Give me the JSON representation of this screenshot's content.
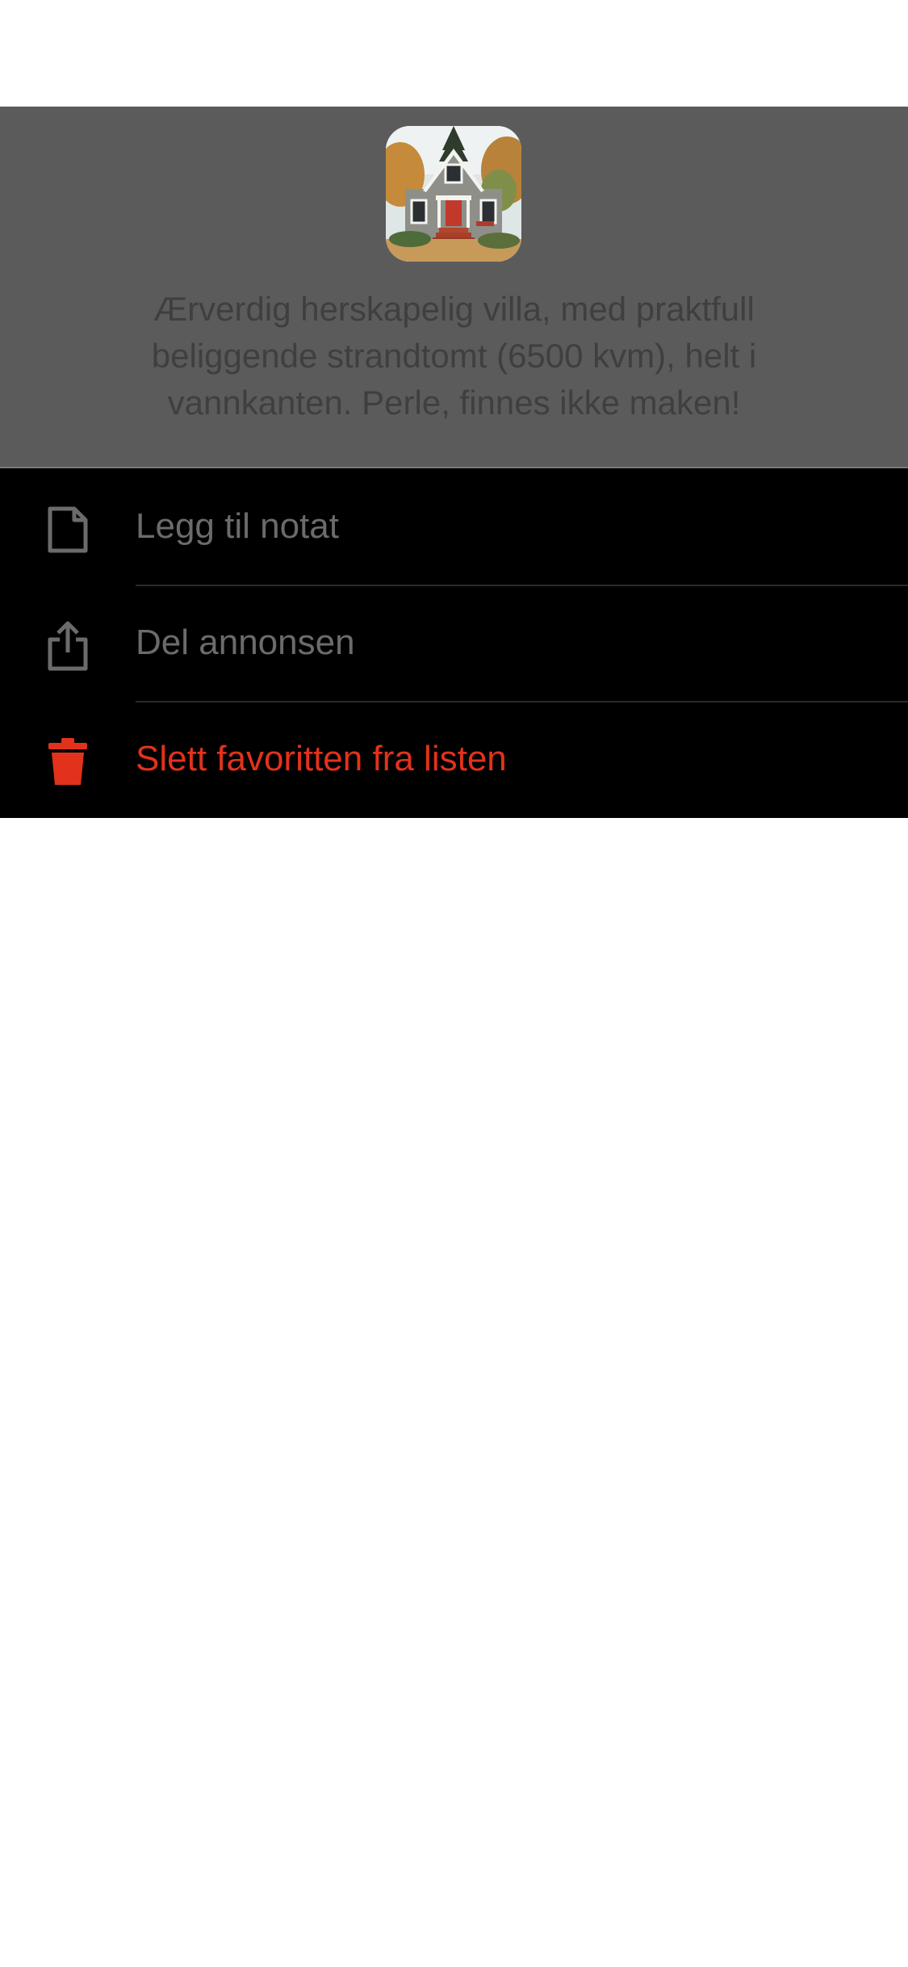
{
  "ad": {
    "title": "Ærverdig herskapelig villa, med praktfull beliggende strandtomt (6500 kvm), helt i vannkanten. Perle, finnes ikke maken!",
    "thumbnail_alt": "House photo"
  },
  "menu": {
    "items": [
      {
        "label": "Legg til notat",
        "icon": "note-icon"
      },
      {
        "label": "Del annonsen",
        "icon": "share-icon"
      },
      {
        "label": "Slett favoritten fra listen",
        "icon": "trash-icon"
      }
    ]
  },
  "colors": {
    "overlay": "#5b5b5b",
    "menu_background": "#000000",
    "menu_text": "#6b6b6b",
    "danger": "#e2321b",
    "title_text": "#3f3f3f"
  }
}
